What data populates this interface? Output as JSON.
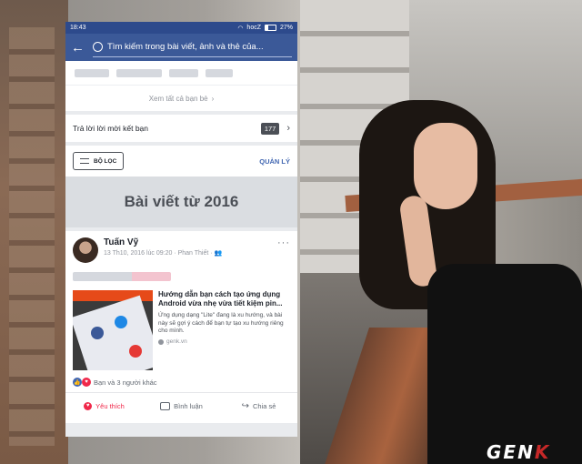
{
  "status_bar": {
    "time": "18:43",
    "carrier": "hocZ",
    "battery": "27%"
  },
  "search": {
    "placeholder": "Tìm kiếm trong bài viết, ảnh và thẻ của..."
  },
  "friends": {
    "see_all_label": "Xem tất cả bạn bè"
  },
  "friend_requests": {
    "label": "Trả lời lời mời kết bạn",
    "count": "177"
  },
  "toolbar": {
    "filter_label": "BỘ LỌC",
    "manage_label": "QUẢN LÝ"
  },
  "section": {
    "title": "Bài viết từ 2016"
  },
  "post": {
    "author": "Tuấn Vỹ",
    "meta": "13 Th10, 2016 lúc 09:20 · Phan Thiết ·",
    "link_title": "Hướng dẫn bạn cách tạo ứng dụng Android vừa nhẹ vừa tiết kiệm pin...",
    "link_desc": "Ứng dụng dạng \"Lite\" đang là xu hướng, và bài này sẽ gợi ý cách để bạn tự tạo xu hướng riêng cho mình.",
    "link_source": "genk.vn",
    "reactions": "Bạn và 3 người khác",
    "actions": {
      "like": "Yêu thích",
      "comment": "Bình luận",
      "share": "Chia sẻ"
    }
  },
  "watermark": {
    "part1": "GEN",
    "part2": "K"
  },
  "colors": {
    "facebook_blue": "#3b5998",
    "love_red": "#f0284a"
  }
}
